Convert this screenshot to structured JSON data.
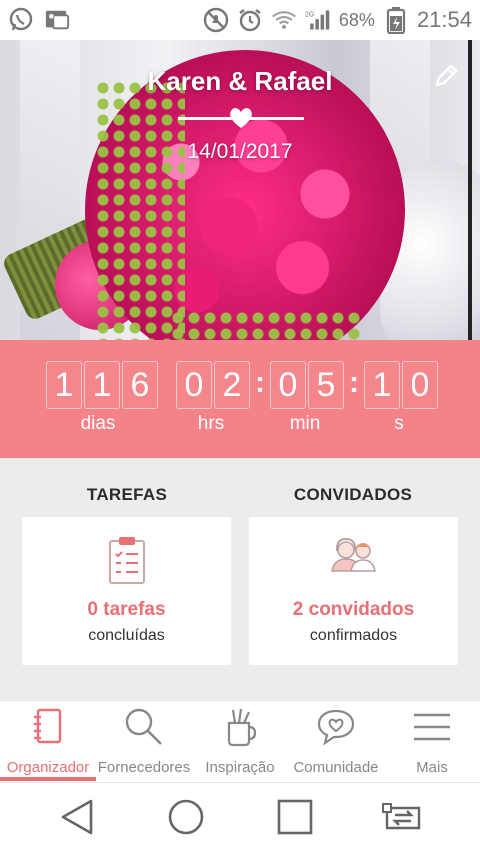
{
  "status_bar": {
    "battery": "68%",
    "time": "21:54",
    "network": "2G",
    "icons": [
      "whatsapp-icon",
      "photo-notification-icon",
      "mute-icon",
      "alarm-icon",
      "wifi-icon",
      "signal-icon",
      "battery-icon"
    ]
  },
  "hero": {
    "couple_names": "Karen & Rafael",
    "wedding_date": "14/01/2017",
    "edit_icon": "pencil-icon"
  },
  "countdown": {
    "days_digits": [
      "1",
      "1",
      "6"
    ],
    "hours_digits": [
      "0",
      "2"
    ],
    "minutes_digits": [
      "0",
      "5"
    ],
    "seconds_digits": [
      "1",
      "0"
    ],
    "separator": ":",
    "days_label": "dias",
    "hours_label": "hrs",
    "minutes_label": "min",
    "seconds_label": "s"
  },
  "summary": {
    "tasks": {
      "title": "TAREFAS",
      "count": "0 tarefas",
      "subtitle": "concluídas",
      "icon": "clipboard-checklist-icon"
    },
    "guests": {
      "title": "CONVIDADOS",
      "count": "2 convidados",
      "subtitle": "confirmados",
      "icon": "couple-guests-icon"
    }
  },
  "bottom_nav": {
    "items": [
      {
        "label": "Organizador",
        "icon": "notebook-icon",
        "active": true
      },
      {
        "label": "Fornecedores",
        "icon": "search-icon",
        "active": false
      },
      {
        "label": "Inspiração",
        "icon": "pencil-cup-icon",
        "active": false
      },
      {
        "label": "Comunidade",
        "icon": "chat-heart-icon",
        "active": false
      },
      {
        "label": "Mais",
        "icon": "menu-icon",
        "active": false
      }
    ]
  },
  "system_nav": {
    "icons": [
      "back-icon",
      "home-icon",
      "recents-icon",
      "switch-app-icon"
    ]
  },
  "colors": {
    "accent": "#e87075",
    "countdown_bg": "#f58288",
    "page_bg": "#ececec"
  }
}
